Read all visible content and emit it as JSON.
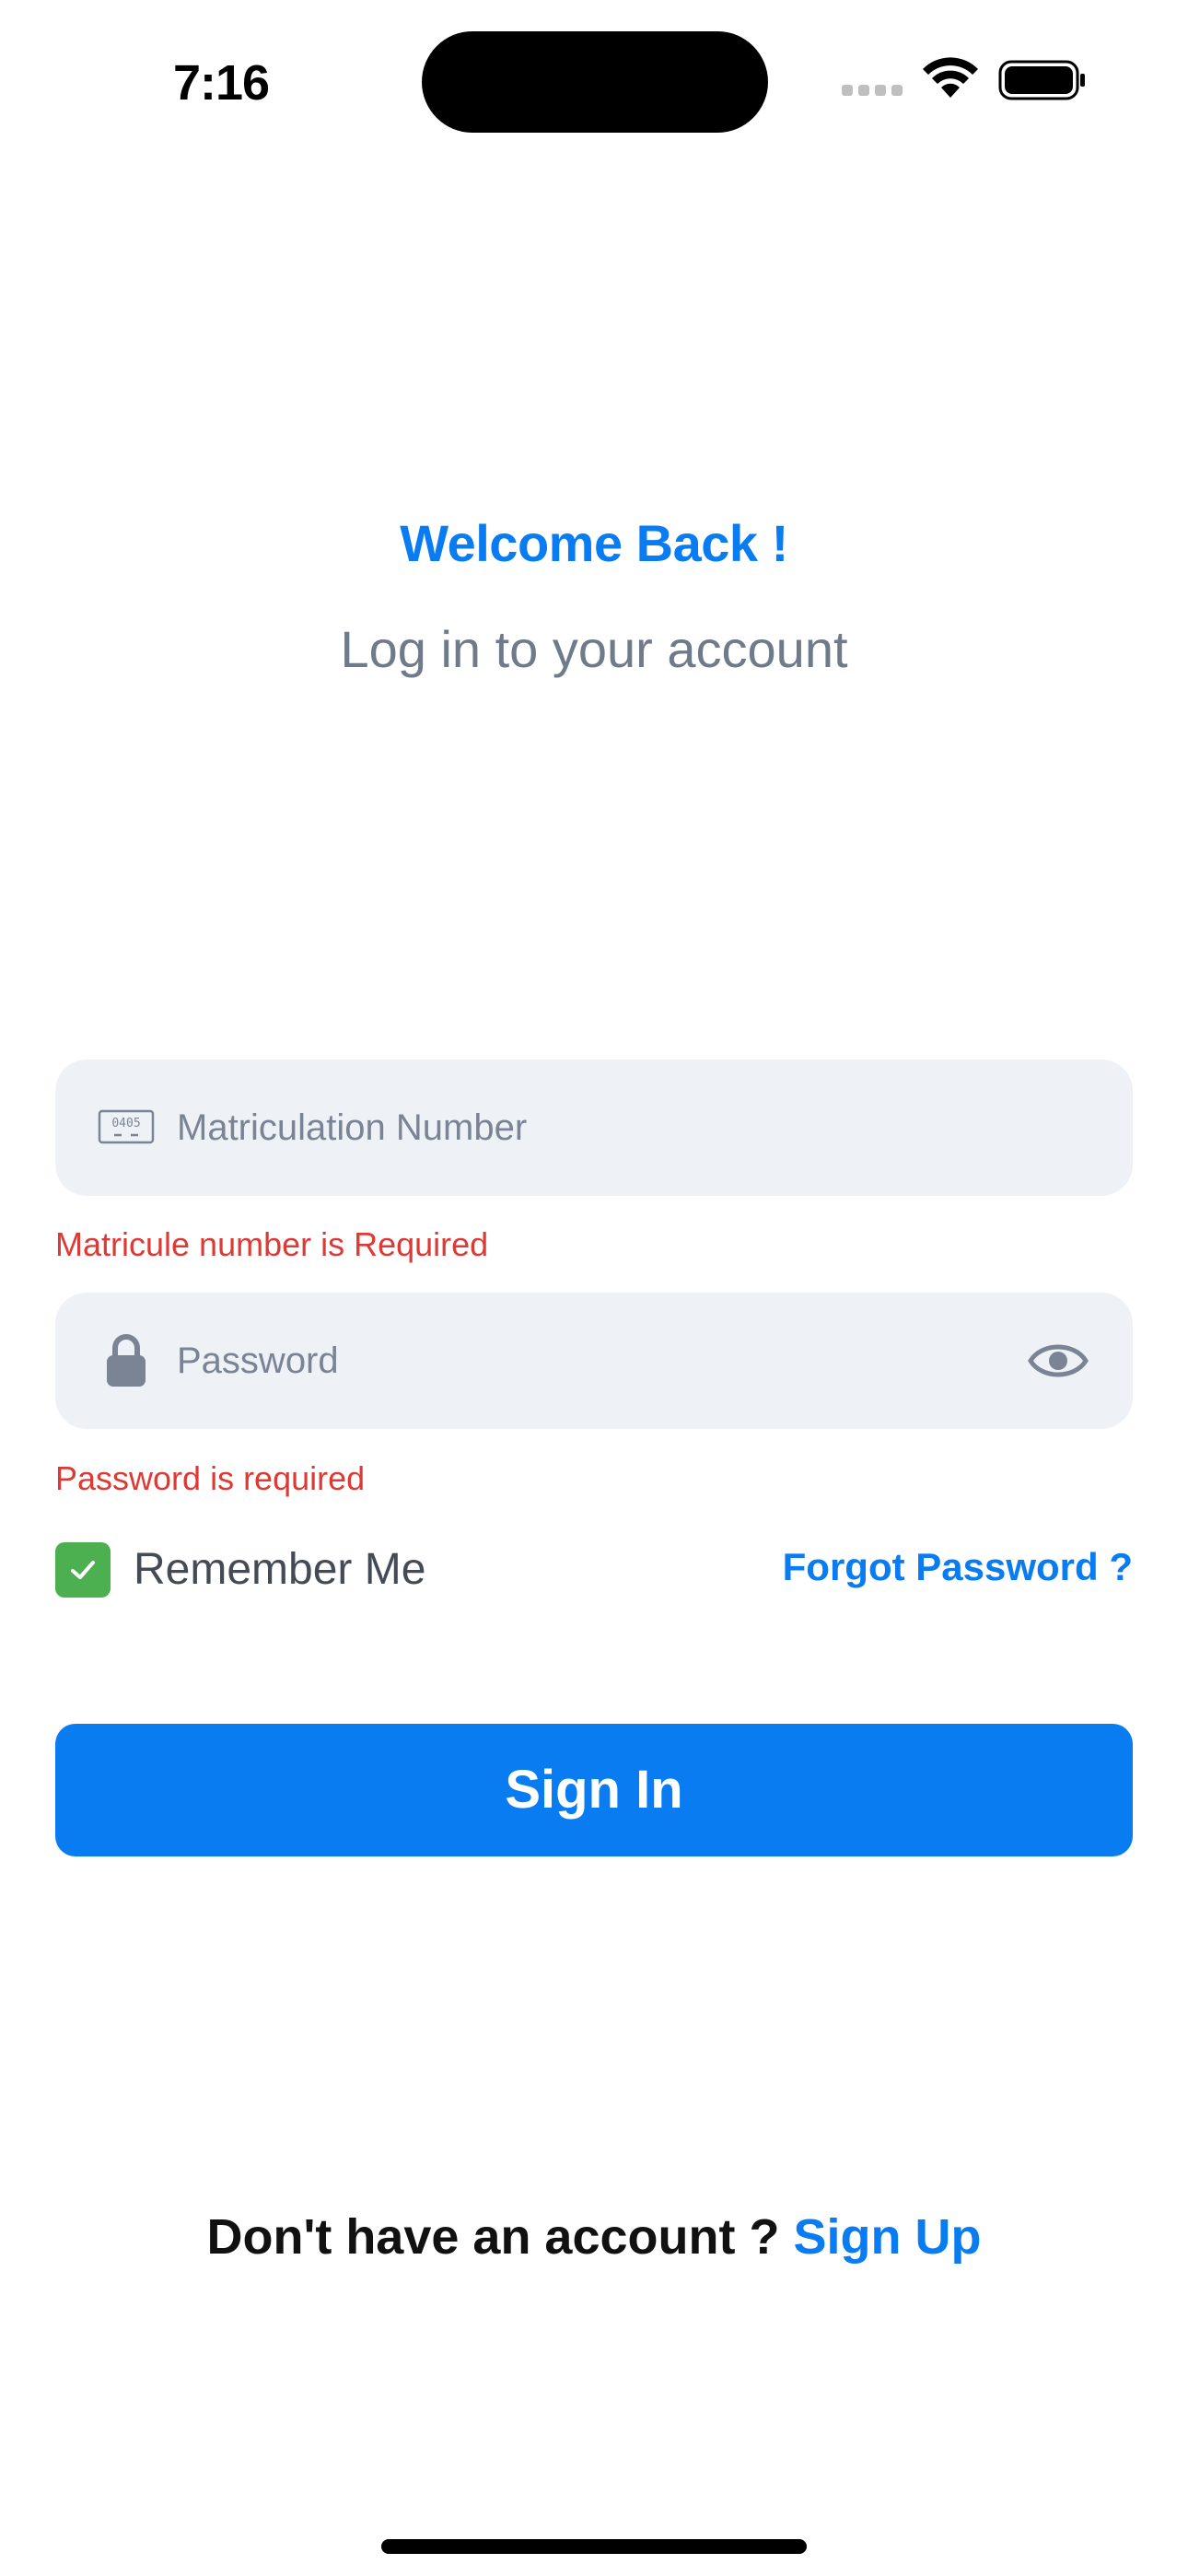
{
  "status_bar": {
    "time": "7:16"
  },
  "header": {
    "title": "Welcome Back !",
    "subtitle": "Log in to your account"
  },
  "form": {
    "matric": {
      "placeholder": "Matriculation Number",
      "icon": "id-number-icon",
      "error": "Matricule number is Required"
    },
    "password": {
      "placeholder": "Password",
      "icon": "lock-icon",
      "toggle_icon": "eye-icon",
      "error": "Password is required"
    },
    "remember": {
      "label": "Remember Me",
      "checked": true
    },
    "forgot_label": "Forgot Password ?",
    "submit_label": "Sign In"
  },
  "footer": {
    "prompt": "Don't have an account ?",
    "link": "Sign Up"
  },
  "colors": {
    "accent": "#0a7cf2",
    "error": "#dd3a35",
    "checkbox": "#4caf50",
    "field_bg": "#eef2f7"
  }
}
